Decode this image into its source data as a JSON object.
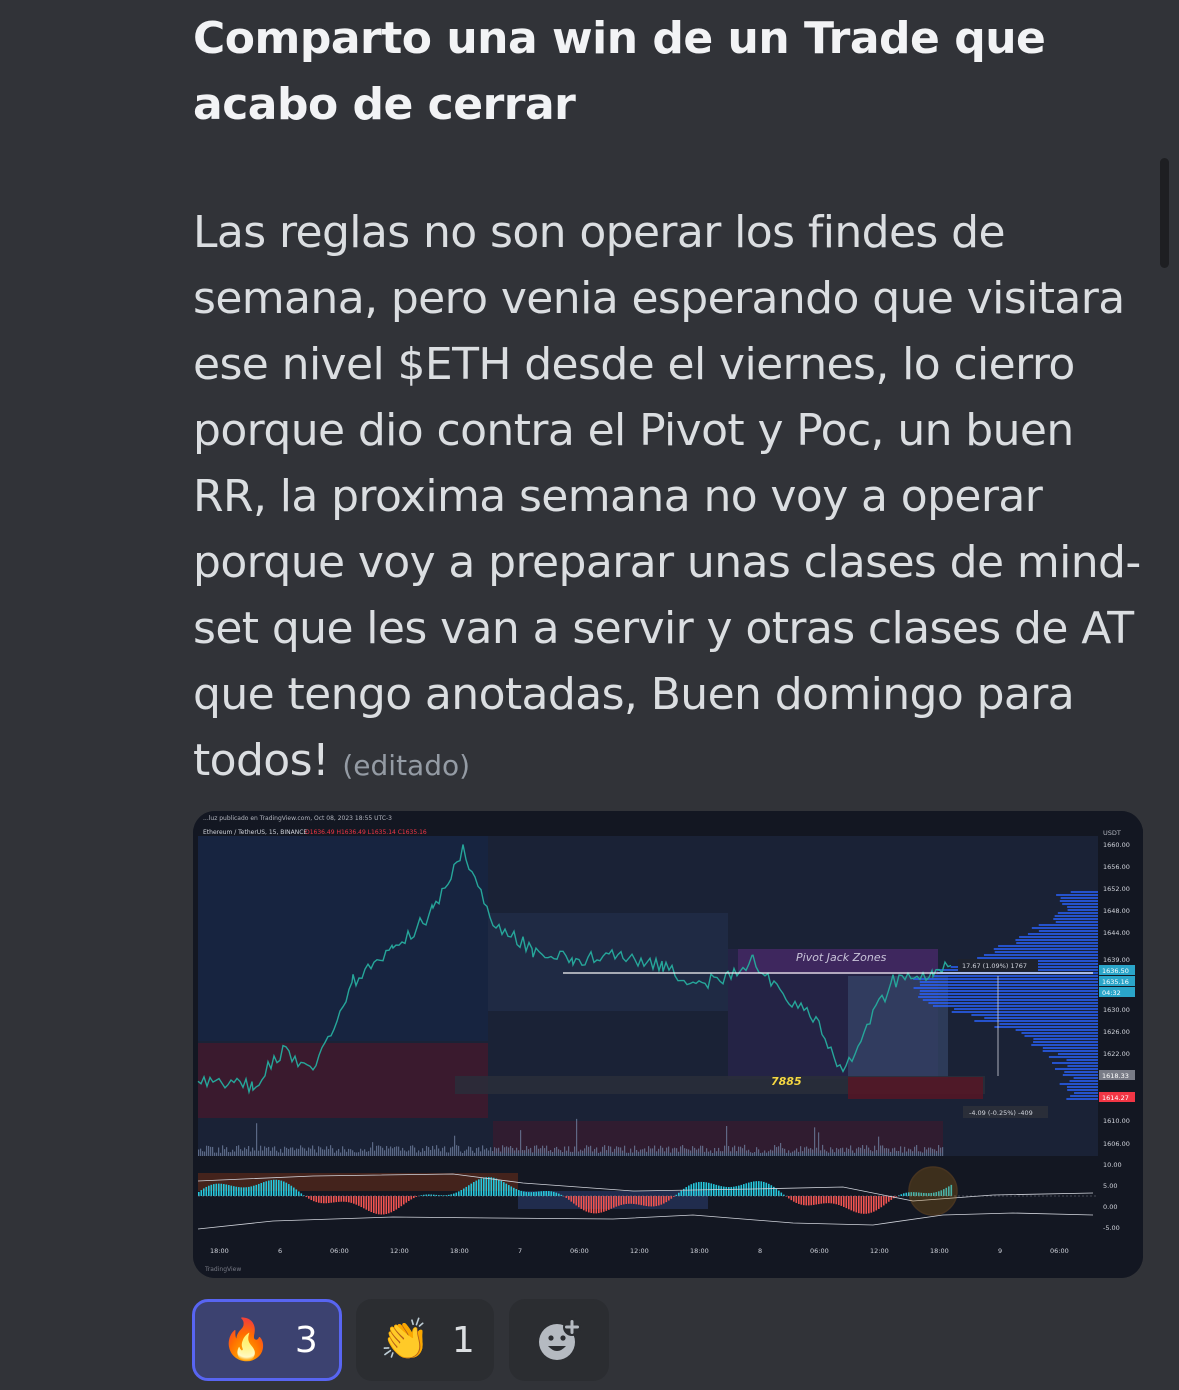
{
  "message": {
    "title": "Comparto una win de un Trade que acabo de cerrar",
    "body": "Las reglas no son operar los findes de semana, pero venia esperando que visitara ese nivel $ETH desde el viernes, lo cierro porque dio contra el Pivot y Poc, un buen RR, la proxima semana no voy a operar porque voy a preparar unas clases de mind-set que les van a servir y otras clases de AT que tengo anotadas, Buen domingo para todos!",
    "edited_label": "(editado)"
  },
  "attachment": {
    "header": "...luz publicado en TradingView.com, Oct 08, 2023 18:55 UTC-3",
    "symbol": "Ethereum / TetherUS, 15, BINANCE",
    "ohlc": "O1636.49 H1636.49 L1635.14 C1635.16",
    "currency": "USDT",
    "price_ticks": [
      "1660.00",
      "1656.00",
      "1652.00",
      "1648.00",
      "1644.00",
      "1639.00",
      "1630.00",
      "1626.00",
      "1622.00",
      "1610.00",
      "1606.00"
    ],
    "price_tags": [
      {
        "text": "1636.50",
        "color": "#2aa5c9"
      },
      {
        "text": "1635.16",
        "color": "#2aa5c9"
      },
      {
        "text": "04:32",
        "color": "#2aa5c9"
      },
      {
        "text": "1618.33",
        "color": "#787b86"
      },
      {
        "text": "1614.27",
        "color": "#f23645"
      }
    ],
    "osc_ticks": [
      "10.00",
      "5.00",
      "0.00",
      "-5.00"
    ],
    "time_ticks": [
      "18:00",
      "6",
      "06:00",
      "12:00",
      "18:00",
      "7",
      "06:00",
      "12:00",
      "18:00",
      "8",
      "06:00",
      "12:00",
      "18:00",
      "9",
      "06:00"
    ],
    "zone_label": "Pivot Jack Zones",
    "volume_label": "7885",
    "measure_up": "17.67 (1.09%) 1767",
    "measure_down": "-4.09 (-0.25%) -409",
    "footer": "TradingView"
  },
  "reactions": [
    {
      "emoji": "🔥",
      "icon": "fire-icon",
      "count": "3",
      "active": true
    },
    {
      "emoji": "👏",
      "icon": "clapping-hands-icon",
      "count": "1",
      "active": false
    }
  ],
  "add_reaction_icon": "add-reaction-icon"
}
